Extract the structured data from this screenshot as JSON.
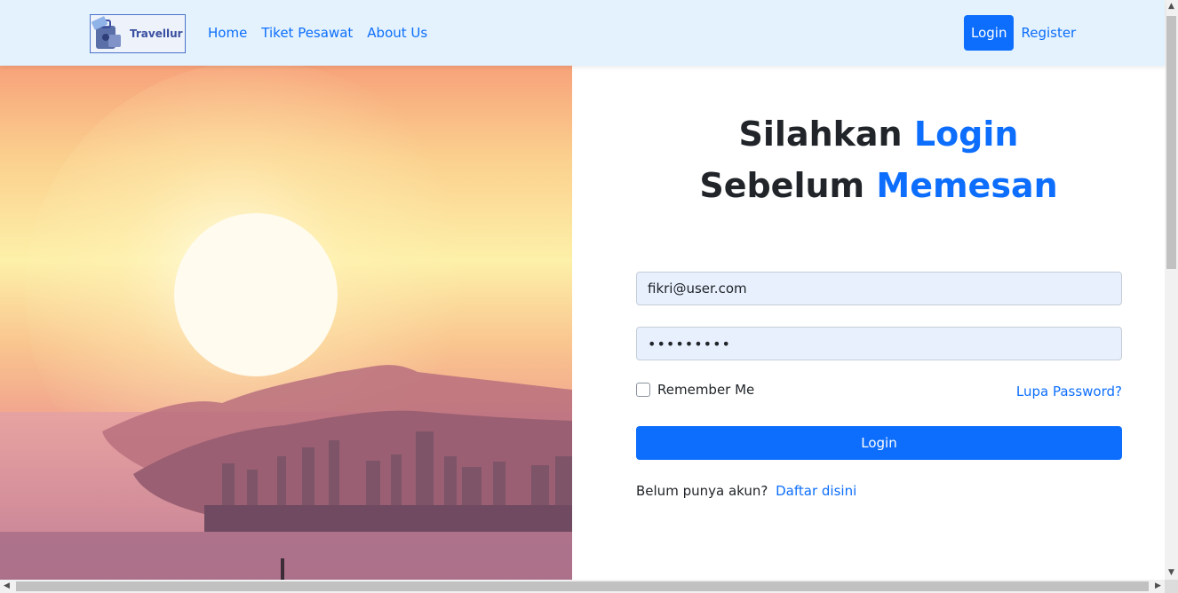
{
  "navbar": {
    "brand_text": "Travellur",
    "links": [
      "Home",
      "Tiket Pesawat",
      "About Us"
    ],
    "login_button": "Login",
    "register_link": "Register"
  },
  "hero": {
    "image": "sunset-coastal-city"
  },
  "form": {
    "heading_line1_plain": "Silahkan",
    "heading_line1_highlight": "Login",
    "heading_line2_plain": "Sebelum",
    "heading_line2_highlight": "Memesan",
    "email_value": "fikri@user.com",
    "password_value": "•••••••••",
    "remember_label": "Remember Me",
    "remember_checked": false,
    "forgot_link": "Lupa Password?",
    "submit_label": "Login",
    "signup_text": "Belum punya akun?",
    "signup_link": "Daftar disini"
  },
  "colors": {
    "accent": "#0d6efd",
    "navbar_bg": "#e3f2fd",
    "input_bg": "#e8f0fe"
  },
  "scrollbars": {
    "up_icon": "arrow-up-icon",
    "down_icon": "arrow-down-icon",
    "left_icon": "arrow-left-icon",
    "right_icon": "arrow-right-icon"
  }
}
